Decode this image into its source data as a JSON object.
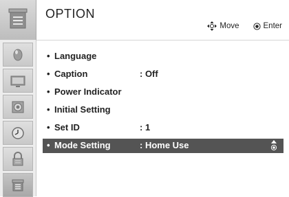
{
  "header": {
    "title": "OPTION",
    "move_label": "Move",
    "enter_label": "Enter"
  },
  "sidebar": {
    "items": [
      {
        "icon": "picture-icon"
      },
      {
        "icon": "screen-icon"
      },
      {
        "icon": "audio-icon"
      },
      {
        "icon": "clock-icon"
      },
      {
        "icon": "lock-icon"
      },
      {
        "icon": "option-icon",
        "active": true
      }
    ]
  },
  "menu": {
    "items": [
      {
        "label": "Language",
        "value": ""
      },
      {
        "label": "Caption",
        "value": ": Off"
      },
      {
        "label": "Power Indicator",
        "value": ""
      },
      {
        "label": "Initial Setting",
        "value": ""
      },
      {
        "label": "Set ID",
        "value": ": 1"
      },
      {
        "label": "Mode Setting",
        "value": ": Home Use",
        "selected": true
      }
    ]
  },
  "colors": {
    "selected_row": "#545454",
    "header_icon_bg": "#cfcfcf"
  }
}
